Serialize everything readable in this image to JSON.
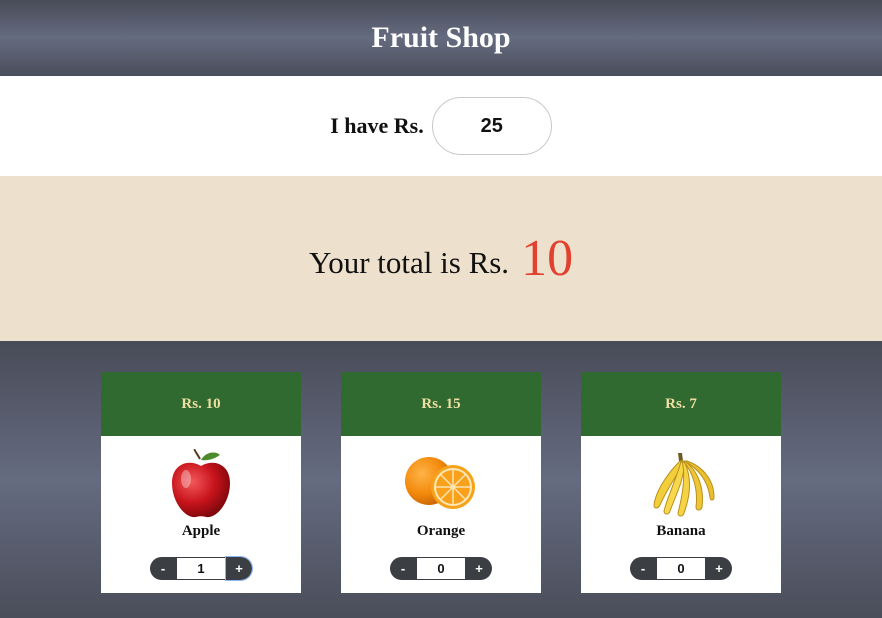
{
  "header": {
    "title": "Fruit Shop"
  },
  "budget": {
    "label": "I have Rs.",
    "value": "25"
  },
  "total": {
    "label": "Your total is Rs.",
    "amount": "10"
  },
  "products": [
    {
      "price": "Rs. 10",
      "name": "Apple",
      "qty": "1",
      "icon": "apple-icon"
    },
    {
      "price": "Rs. 15",
      "name": "Orange",
      "qty": "0",
      "icon": "orange-icon"
    },
    {
      "price": "Rs. 7",
      "name": "Banana",
      "qty": "0",
      "icon": "banana-icon"
    }
  ],
  "stepper": {
    "minus": "-",
    "plus": "+"
  },
  "colors": {
    "accent": "#e1412e",
    "card_header": "#306a31",
    "price_text": "#eedfa3",
    "total_bg": "#ede0cc"
  }
}
